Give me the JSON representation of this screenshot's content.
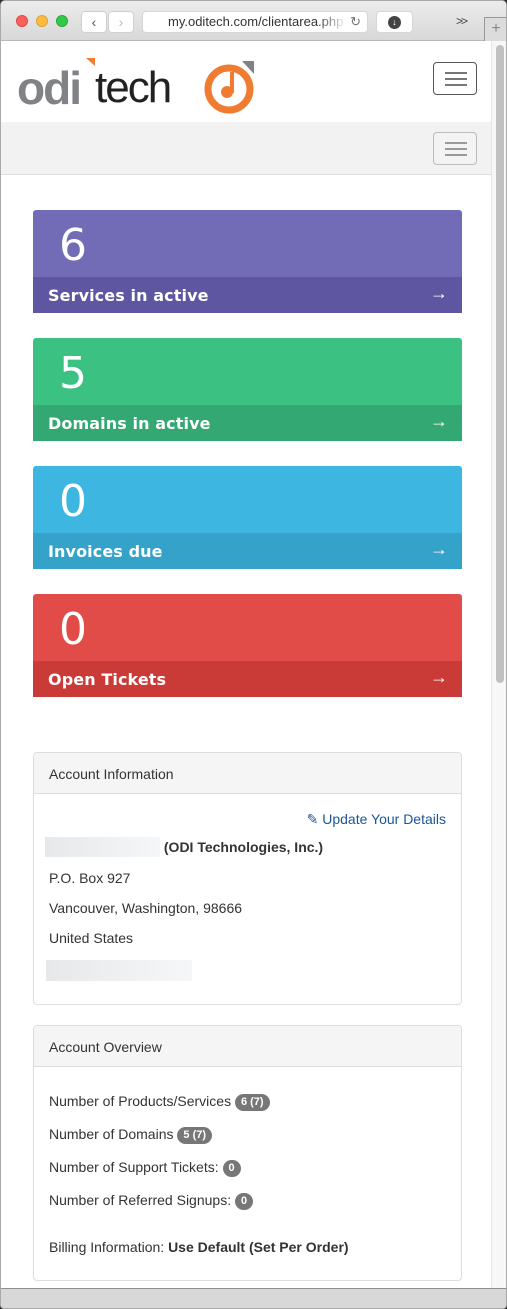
{
  "browser": {
    "url": "my.oditech.com/clientarea.php",
    "back_icon": "chevron-left",
    "forward_icon": "chevron-right",
    "reload_icon": "reload",
    "download_icon": "download-circle",
    "overflow_label": ">>",
    "new_tab_label": "+"
  },
  "header": {
    "logo_text_bold": "odi",
    "logo_text_light": "tech",
    "brand_colors": {
      "gray": "#808285",
      "orange": "#f07c32"
    }
  },
  "tiles": [
    {
      "count": "6",
      "label": "Services in active",
      "arrow": "→",
      "color": "#726bb5",
      "footer_color": "#5e56a0"
    },
    {
      "count": "5",
      "label": "Domains in active",
      "arrow": "→",
      "color": "#3bc283",
      "footer_color": "#33a872"
    },
    {
      "count": "0",
      "label": "Invoices due",
      "arrow": "→",
      "color": "#3db7e2",
      "footer_color": "#35a3c9"
    },
    {
      "count": "0",
      "label": "Open Tickets",
      "arrow": "→",
      "color": "#e24c48",
      "footer_color": "#ca3b37"
    }
  ],
  "account_info": {
    "title": "Account Information",
    "update_link": "Update Your Details",
    "company": "(ODI Technologies, Inc.)",
    "address1": "P.O. Box 927",
    "city_line": "Vancouver, Washington, 98666",
    "country": "United States"
  },
  "account_overview": {
    "title": "Account Overview",
    "items": [
      {
        "label": "Number of Products/Services",
        "badge": "6 (7)"
      },
      {
        "label": "Number of Domains",
        "badge": "5 (7)"
      },
      {
        "label": "Number of Support Tickets:",
        "badge": "0"
      },
      {
        "label": "Number of Referred Signups:",
        "badge": "0"
      }
    ],
    "billing_label": "Billing Information:",
    "billing_value": "Use Default (Set Per Order)"
  }
}
